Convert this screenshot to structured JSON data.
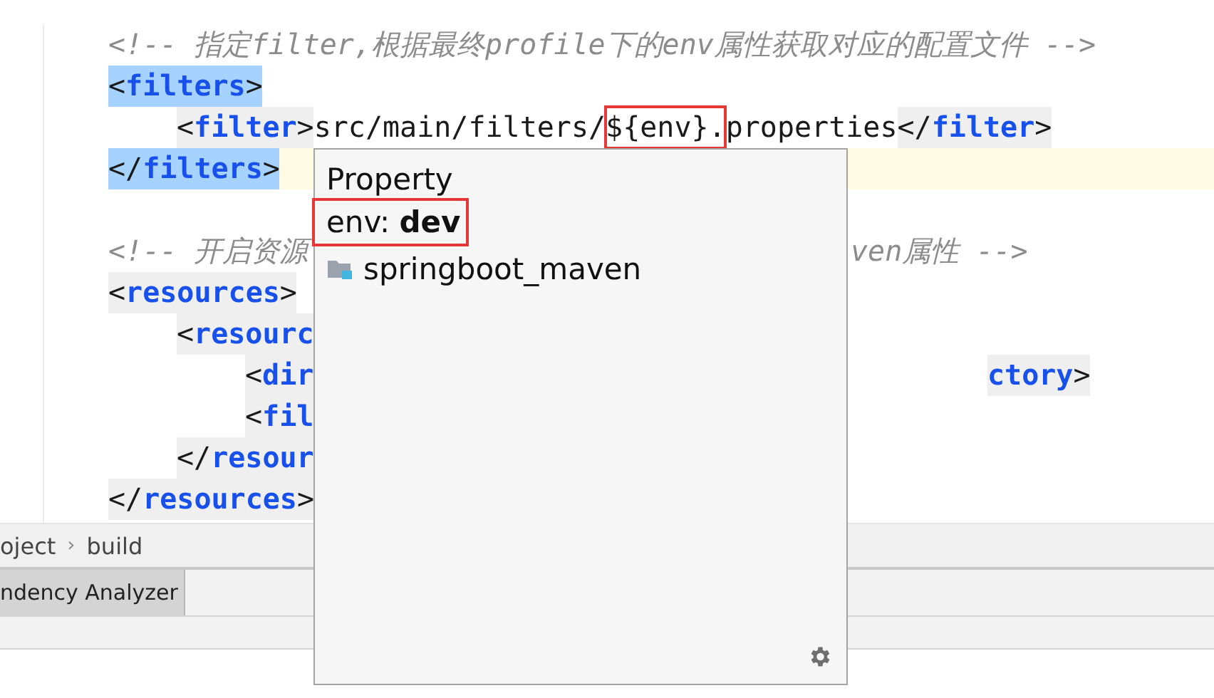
{
  "editor": {
    "lines": [
      {
        "kind": "code",
        "tokens": [
          {
            "kind": "comment",
            "text": "<!-- 指定filter,根据最终profile下的env属性获取对应的配置文件 -->",
            "selected": false
          }
        ]
      },
      {
        "kind": "code",
        "tokens": [
          {
            "kind": "bracket",
            "text": "<",
            "selected": true
          },
          {
            "kind": "tagname",
            "text": "filters",
            "selected": true
          },
          {
            "kind": "bracket",
            "text": ">",
            "selected": true
          }
        ],
        "children": [
          {
            "kind": "code",
            "tokens": [
              {
                "kind": "bracket",
                "text": "<",
                "selected": false
              },
              {
                "kind": "tagname",
                "text": "filter",
                "selected": false
              },
              {
                "kind": "bracket",
                "text": ">",
                "selected": false
              },
              {
                "kind": "text",
                "text": "src/main/filters/",
                "selected": false
              },
              {
                "kind": "text",
                "text": "${env}.",
                "boxed": true,
                "selected": false
              },
              {
                "kind": "text",
                "text": "properties",
                "selected": false
              },
              {
                "kind": "bracket",
                "text": "</",
                "selected": false
              },
              {
                "kind": "tagname",
                "text": "filter",
                "selected": false
              },
              {
                "kind": "bracket",
                "text": ">",
                "selected": false
              }
            ]
          }
        ]
      },
      {
        "kind": "code",
        "current": true,
        "tokens": [
          {
            "kind": "bracket",
            "text": "</",
            "selected": true
          },
          {
            "kind": "tagname",
            "text": "filters",
            "selected": true
          },
          {
            "kind": "bracket",
            "text": ">",
            "selected": true
          }
        ]
      },
      {
        "kind": "blank"
      },
      {
        "kind": "code",
        "tokens": [
          {
            "kind": "comment",
            "text": "<!-- 开启资源",
            "selected": false
          }
        ],
        "right": [
          {
            "kind": "comment",
            "text": "ven属性 -->",
            "selected": false
          }
        ]
      },
      {
        "kind": "code",
        "tokens": [
          {
            "kind": "bracket",
            "text": "<",
            "selected": false
          },
          {
            "kind": "tagname",
            "text": "resources",
            "selected": false
          },
          {
            "kind": "bracket",
            "text": ">",
            "selected": false
          }
        ],
        "children": [
          {
            "kind": "code",
            "tokens": [
              {
                "kind": "bracket",
                "text": "<",
                "selected": false
              },
              {
                "kind": "tagname",
                "text": "resourc",
                "selected": false
              }
            ],
            "children": [
              {
                "kind": "code",
                "tokens": [
                  {
                    "kind": "bracket",
                    "text": "<",
                    "selected": false
                  },
                  {
                    "kind": "tagname",
                    "text": "dir",
                    "selected": false
                  }
                ],
                "right": [
                  {
                    "kind": "tagname",
                    "text": "ctory",
                    "selected": false
                  },
                  {
                    "kind": "bracket",
                    "text": ">",
                    "selected": false
                  }
                ]
              },
              {
                "kind": "code",
                "tokens": [
                  {
                    "kind": "bracket",
                    "text": "<",
                    "selected": false
                  },
                  {
                    "kind": "tagname",
                    "text": "fil",
                    "selected": false
                  }
                ]
              }
            ]
          },
          {
            "kind": "code",
            "tokens": [
              {
                "kind": "bracket",
                "text": "</",
                "selected": false
              },
              {
                "kind": "tagname",
                "text": "resour",
                "selected": false
              }
            ]
          }
        ]
      },
      {
        "kind": "code",
        "tokens": [
          {
            "kind": "bracket",
            "text": "</",
            "selected": false
          },
          {
            "kind": "tagname",
            "text": "resources",
            "selected": false
          },
          {
            "kind": "bracket",
            "text": ">",
            "selected": false
          }
        ]
      }
    ]
  },
  "popup": {
    "title": "Property",
    "value": "env: **dev**",
    "value_boxed": true,
    "items": [
      {
        "label": "springboot_maven"
      }
    ]
  },
  "breadcrumb": {
    "separator": "›",
    "items": [
      "oject",
      "build"
    ]
  },
  "tool_tabs": [
    {
      "label": "ndency Analyzer",
      "selected": true
    }
  ]
}
